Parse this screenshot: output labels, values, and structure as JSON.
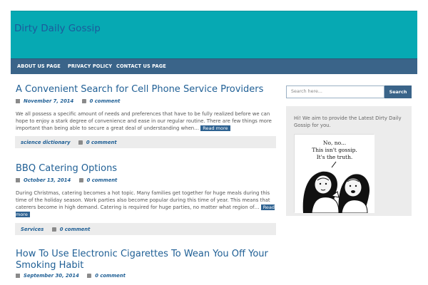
{
  "site": {
    "title": "Dirty Daily Gossip"
  },
  "nav": {
    "items": [
      "ABOUT US PAGE",
      "PRIVACY POLICY",
      "CONTACT US PAGE"
    ]
  },
  "posts": [
    {
      "title": "A Convenient Search for Cell Phone Service Providers",
      "date": "November 7, 2014",
      "comments": "0 comment",
      "excerpt": "We all possess a specific amount of needs and preferences that have to be fully realized before we can hope to enjoy a stark degree of convenience and ease in our regular routine. There are few things more important than being able to secure a great deal of understanding when…",
      "read_more": "Read more",
      "category": "science dictionary"
    },
    {
      "title": "BBQ Catering Options",
      "date": "October 13, 2014",
      "comments": "0 comment",
      "excerpt": "During Christmas, catering becomes a hot topic. Many families get together for huge meals during this time of the holiday season. Work parties also become popular during this time of year. This means that caterers become in high demand. Catering is required for huge parties, no matter what region of…",
      "read_more": "Read more",
      "category": "Services"
    },
    {
      "title": "How To Use Electronic Cigarettes To Wean You Off Your Smoking Habit",
      "date": "September 30, 2014",
      "comments": "0 comment"
    }
  ],
  "sidebar": {
    "search_placeholder": "Search here...",
    "search_button": "Search",
    "widget_text": "Hi! We aim to provide the Latest Dirty Daily Gossip for you.",
    "image_caption": "No, no...\nThis isn't gossip.\nIt's the truth."
  },
  "icons": {
    "date": "calendar-icon",
    "comments": "comment-icon"
  },
  "colors": {
    "header_bg": "#06a9b3",
    "nav_bg": "#3a6489",
    "title_color": "#1f5f95",
    "meta_bar": "#ececec"
  }
}
